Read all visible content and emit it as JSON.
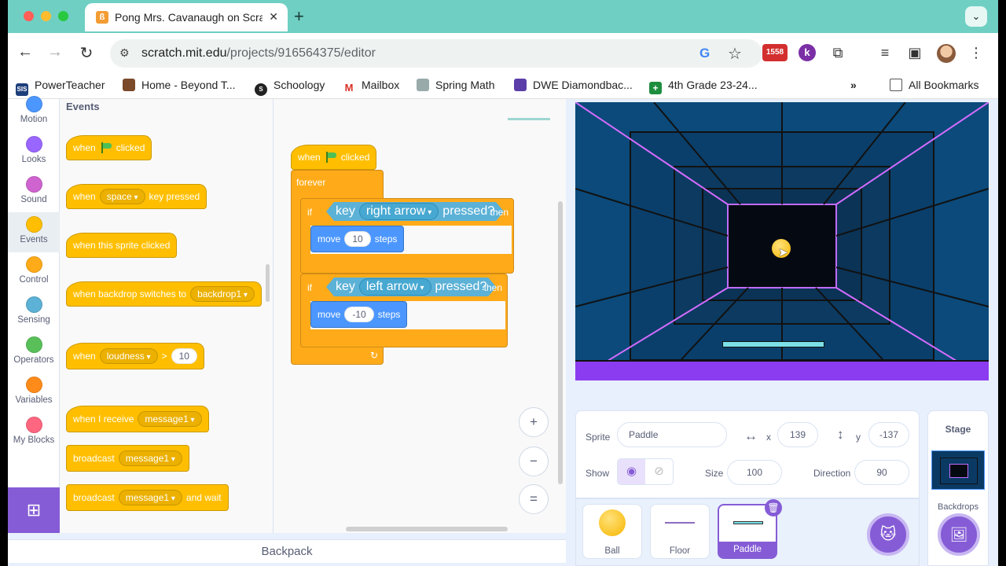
{
  "browser": {
    "tab_title": "Pong Mrs. Cavanaugh on Scratch",
    "url_host": "scratch.mit.edu",
    "url_path": "/projects/916564375/editor",
    "badge_count": "1558",
    "bookmarks": [
      "PowerTeacher",
      "Home - Beyond T...",
      "Schoology",
      "Mailbox",
      "Spring Math",
      "DWE Diamondbac...",
      "4th Grade 23-24...",
      "All Bookmarks"
    ]
  },
  "categories": [
    {
      "label": "Motion",
      "color": "#4c97ff"
    },
    {
      "label": "Looks",
      "color": "#9966ff"
    },
    {
      "label": "Sound",
      "color": "#cf63cf"
    },
    {
      "label": "Events",
      "color": "#ffbf00"
    },
    {
      "label": "Control",
      "color": "#ffab19"
    },
    {
      "label": "Sensing",
      "color": "#5cb1d6"
    },
    {
      "label": "Operators",
      "color": "#59c059"
    },
    {
      "label": "Variables",
      "color": "#ff8c1a"
    },
    {
      "label": "My Blocks",
      "color": "#ff6680"
    }
  ],
  "palette": {
    "title": "Events",
    "when": "when",
    "clicked": "clicked",
    "space": "space",
    "key_pressed": "key pressed",
    "this_sprite_clicked": "when this sprite clicked",
    "backdrop_switches": "when backdrop switches to",
    "backdrop1": "backdrop1",
    "loudness": "loudness",
    "gt": ">",
    "ten": "10",
    "when_i_receive": "when I receive",
    "message1": "message1",
    "broadcast": "broadcast",
    "and_wait": "and wait"
  },
  "script": {
    "when": "when",
    "clicked": "clicked",
    "forever": "forever",
    "if": "if",
    "then": "then",
    "key": "key",
    "right_arrow": "right arrow",
    "left_arrow": "left arrow",
    "pressed": "pressed?",
    "move": "move",
    "steps": "steps",
    "move_right": "10",
    "move_left": "-10"
  },
  "zoom": {
    "in": "+",
    "out": "−",
    "reset": "="
  },
  "backpack": "Backpack",
  "sprite_info": {
    "sprite_label": "Sprite",
    "sprite_name": "Paddle",
    "x_label": "x",
    "x_value": "139",
    "y_label": "y",
    "y_value": "-137",
    "show_label": "Show",
    "size_label": "Size",
    "size_value": "100",
    "direction_label": "Direction",
    "direction_value": "90"
  },
  "sprites": [
    "Ball",
    "Floor",
    "Paddle"
  ],
  "stage_panel": {
    "title": "Stage",
    "backdrops_label": "Backdrops"
  }
}
